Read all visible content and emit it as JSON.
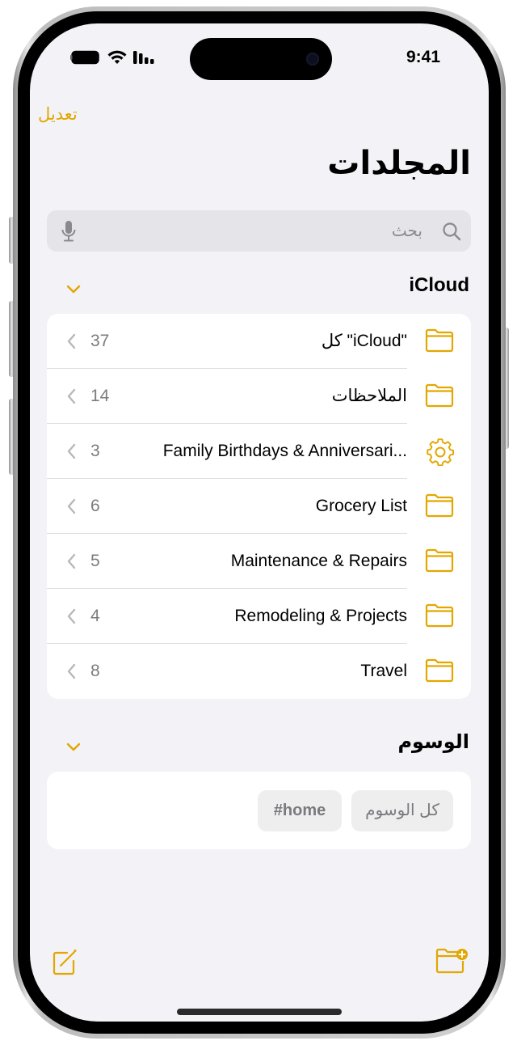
{
  "status_bar": {
    "time": "9:41",
    "icons": [
      "battery-icon",
      "wifi-icon",
      "signal-icon"
    ]
  },
  "nav": {
    "edit_label": "تعديل",
    "title": "المجلدات"
  },
  "search": {
    "placeholder": "بحث",
    "icons": [
      "search-icon",
      "microphone-icon"
    ]
  },
  "icloud_section": {
    "header": "iCloud",
    "folders": [
      {
        "name": "كل \"iCloud\"",
        "count": "37",
        "icon": "folder-icon"
      },
      {
        "name": "الملاحظات",
        "count": "14",
        "icon": "folder-icon"
      },
      {
        "name": "Family Birthdays & Anniversari...",
        "count": "3",
        "icon": "gear-icon"
      },
      {
        "name": "Grocery List",
        "count": "6",
        "icon": "folder-icon"
      },
      {
        "name": "Maintenance & Repairs",
        "count": "5",
        "icon": "folder-icon"
      },
      {
        "name": "Remodeling & Projects",
        "count": "4",
        "icon": "folder-icon"
      },
      {
        "name": "Travel",
        "count": "8",
        "icon": "folder-icon"
      }
    ]
  },
  "tags_section": {
    "header": "الوسوم",
    "tags": [
      "كل الوسوم",
      "#home"
    ]
  },
  "toolbar": {
    "left_icon": "compose-icon",
    "right_icon": "new-folder-icon"
  },
  "colors": {
    "accent": "#e3a700",
    "background": "#f2f2f7",
    "card": "#ffffff",
    "secondary_text": "#7c7c80"
  }
}
